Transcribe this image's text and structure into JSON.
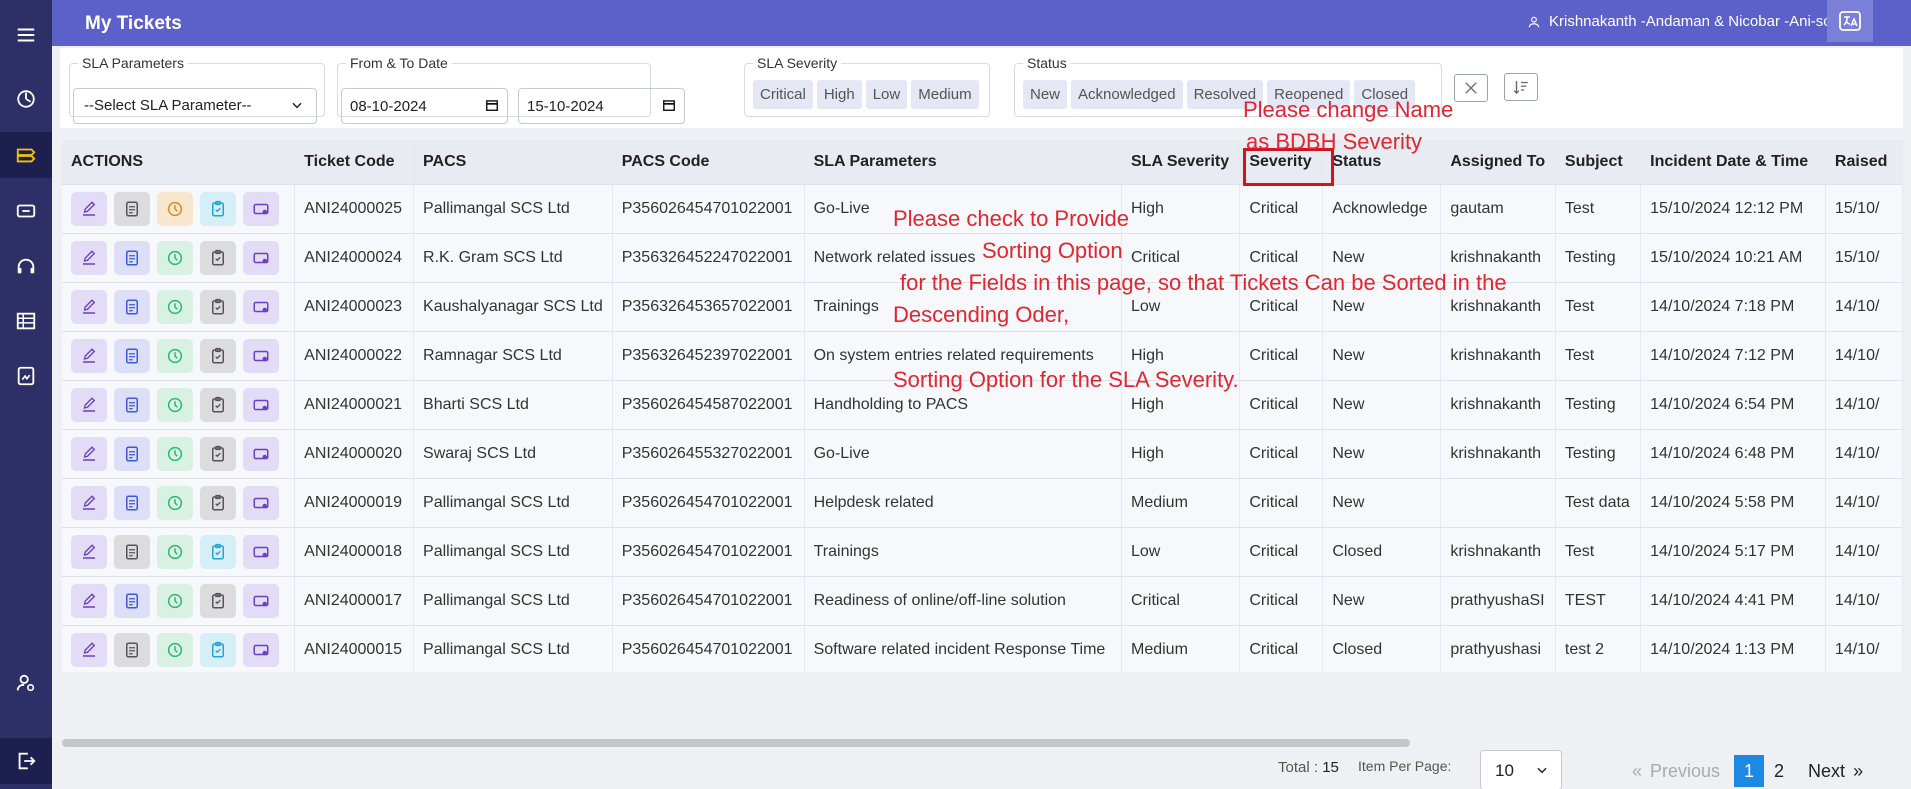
{
  "header": {
    "title": "My Tickets",
    "user": "Krishnakanth -Andaman & Nicobar -Ani-sc"
  },
  "sidebar": {
    "items": [
      {
        "icon": "menu-icon"
      },
      {
        "icon": "dashboard-icon"
      },
      {
        "icon": "tickets-icon",
        "active": true
      },
      {
        "icon": "raise-ticket-icon"
      },
      {
        "icon": "headset-icon"
      },
      {
        "icon": "report-icon"
      },
      {
        "icon": "document-icon"
      },
      {
        "icon": "user-settings-icon"
      },
      {
        "icon": "logout-icon"
      }
    ]
  },
  "filters": {
    "sla_parameters": {
      "legend": "SLA Parameters",
      "value": "--Select SLA Parameter--"
    },
    "date_range": {
      "legend": "From & To Date",
      "from": "08-10-2024",
      "to": "15-10-2024"
    },
    "sla_severity": {
      "legend": "SLA Severity",
      "options": [
        "Critical",
        "High",
        "Low",
        "Medium"
      ]
    },
    "status": {
      "legend": "Status",
      "options": [
        "New",
        "Acknowledged",
        "Resolved",
        "Reopened",
        "Closed"
      ]
    }
  },
  "table": {
    "columns": [
      "ACTIONS",
      "Ticket Code",
      "PACS",
      "PACS Code",
      "SLA Parameters",
      "SLA Severity",
      "Severity",
      "Status",
      "Assigned To",
      "Subject",
      "Incident Date & Time",
      "Raised"
    ],
    "rows": [
      [
        "ANI24000025",
        "Pallimangal SCS Ltd",
        "P356026454701022001",
        "Go-Live",
        "High",
        "Critical",
        "Acknowledge",
        "gautam",
        "Test",
        "15/10/2024 12:12 PM",
        "15/10/"
      ],
      [
        "ANI24000024",
        "R.K. Gram SCS Ltd",
        "P356326452247022001",
        "Network related issues",
        "Critical",
        "Critical",
        "New",
        "krishnakanth",
        "Testing",
        "15/10/2024 10:21 AM",
        "15/10/"
      ],
      [
        "ANI24000023",
        "Kaushalyanagar SCS Ltd",
        "P356326453657022001",
        "Trainings",
        "Low",
        "Critical",
        "New",
        "krishnakanth",
        "Test",
        "14/10/2024 7:18 PM",
        "14/10/"
      ],
      [
        "ANI24000022",
        "Ramnagar SCS Ltd",
        "P356326452397022001",
        "On system entries related requirements",
        "High",
        "Critical",
        "New",
        "krishnakanth",
        "Test",
        "14/10/2024 7:12 PM",
        "14/10/"
      ],
      [
        "ANI24000021",
        "Bharti SCS Ltd",
        "P356026454587022001",
        "Handholding to PACS",
        "High",
        "Critical",
        "New",
        "krishnakanth",
        "Testing",
        "14/10/2024 6:54 PM",
        "14/10/"
      ],
      [
        "ANI24000020",
        "Swaraj SCS Ltd",
        "P356026455327022001",
        "Go-Live",
        "High",
        "Critical",
        "New",
        "krishnakanth",
        "Testing",
        "14/10/2024 6:48 PM",
        "14/10/"
      ],
      [
        "ANI24000019",
        "Pallimangal SCS Ltd",
        "P356026454701022001",
        "Helpdesk related",
        "Medium",
        "Critical",
        "New",
        "",
        "Test data",
        "14/10/2024 5:58 PM",
        "14/10/"
      ],
      [
        "ANI24000018",
        "Pallimangal SCS Ltd",
        "P356026454701022001",
        "Trainings",
        "Low",
        "Critical",
        "Closed",
        "krishnakanth",
        "Test",
        "14/10/2024 5:17 PM",
        "14/10/"
      ],
      [
        "ANI24000017",
        "Pallimangal SCS Ltd",
        "P356026454701022001",
        "Readiness of online/off-line solution",
        "Critical",
        "Critical",
        "New",
        "prathyushaSI",
        "TEST",
        "14/10/2024 4:41 PM",
        "14/10/"
      ],
      [
        "ANI24000015",
        "Pallimangal SCS Ltd",
        "P356026454701022001",
        "Software related incident Response Time",
        "Medium",
        "Critical",
        "Closed",
        "prathyushasi",
        "test 2",
        "14/10/2024 1:13 PM",
        "14/10/"
      ]
    ],
    "row_action_styles": [
      {
        "doc": "grey",
        "clock": "orange",
        "clip": "blue"
      },
      {
        "doc": "blue",
        "clock": "green",
        "clip": "grey"
      },
      {
        "doc": "blue",
        "clock": "green",
        "clip": "grey"
      },
      {
        "doc": "blue",
        "clock": "green",
        "clip": "grey"
      },
      {
        "doc": "blue",
        "clock": "green",
        "clip": "grey"
      },
      {
        "doc": "blue",
        "clock": "green",
        "clip": "grey"
      },
      {
        "doc": "blue",
        "clock": "green",
        "clip": "grey"
      },
      {
        "doc": "grey",
        "clock": "green",
        "clip": "blue"
      },
      {
        "doc": "blue",
        "clock": "green",
        "clip": "grey"
      },
      {
        "doc": "grey",
        "clock": "green",
        "clip": "blue"
      }
    ]
  },
  "footer": {
    "total_label": "Total :",
    "total_value": "15",
    "items_per_page_label": "Item Per Page:",
    "items_per_page_value": "10",
    "previous": "Previous",
    "prev_symbol": "«",
    "pages": [
      "1",
      "2"
    ],
    "next": "Next",
    "next_symbol": "»"
  },
  "annotations": {
    "rename_line1": "Please change Name",
    "rename_line2": "as BDBH Severity",
    "sort_line1": "Please check to Provide",
    "sort_line2": "Sorting Option",
    "sort_line3": "for the Fields in this page, so that Tickets Can be Sorted in the",
    "sort_line4": "Descending Oder,",
    "sort_line5": "Sorting Option for the SLA Severity."
  },
  "colors": {
    "header": "#5b61c8",
    "sidebar": "#2d2f66",
    "annotation": "#e0262e",
    "active_page": "#1e88e5"
  }
}
